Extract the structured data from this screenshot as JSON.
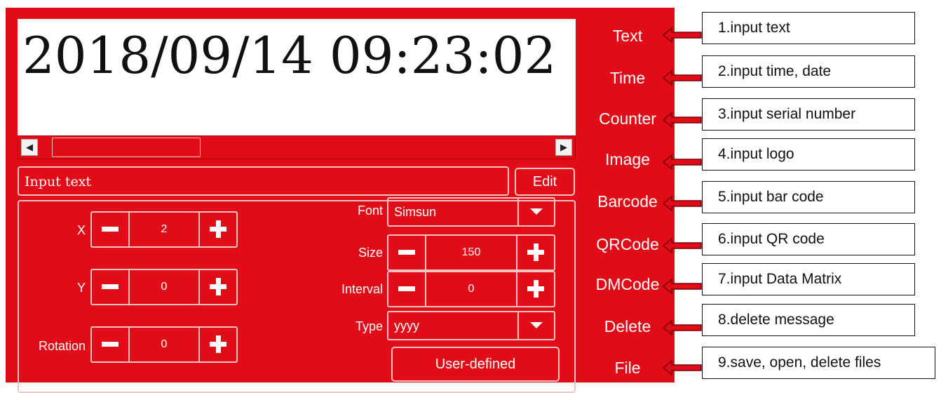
{
  "preview": {
    "text": "2018/09/14 09:23:02"
  },
  "scroll": {
    "left_glyph": "◀",
    "right_glyph": "▶"
  },
  "input": {
    "placeholder": "Input text",
    "edit_label": "Edit"
  },
  "fields": {
    "x": {
      "label": "X",
      "value": "2"
    },
    "y": {
      "label": "Y",
      "value": "0"
    },
    "rotation": {
      "label": "Rotation",
      "value": "0"
    },
    "font": {
      "label": "Font",
      "value": "Simsun"
    },
    "size": {
      "label": "Size",
      "value": "150"
    },
    "interval": {
      "label": "Interval",
      "value": "0"
    },
    "type": {
      "label": "Type",
      "value": "yyyy"
    },
    "user_defined_label": "User-defined"
  },
  "menu": [
    {
      "label": "Text"
    },
    {
      "label": "Time"
    },
    {
      "label": "Counter"
    },
    {
      "label": "Image"
    },
    {
      "label": "Barcode"
    },
    {
      "label": "QRCode"
    },
    {
      "label": "DMCode"
    },
    {
      "label": "Delete"
    },
    {
      "label": "File"
    }
  ],
  "callouts": [
    "1.input text",
    "2.input time, date",
    "3.input serial number",
    "4.input logo",
    "5.input bar code",
    "6.input QR code",
    "7.input Data Matrix",
    "8.delete message",
    "9.save, open, delete files"
  ],
  "colors": {
    "panel": "#e20c18",
    "border": "#f4c4c4",
    "arrow": "#e20c18"
  }
}
